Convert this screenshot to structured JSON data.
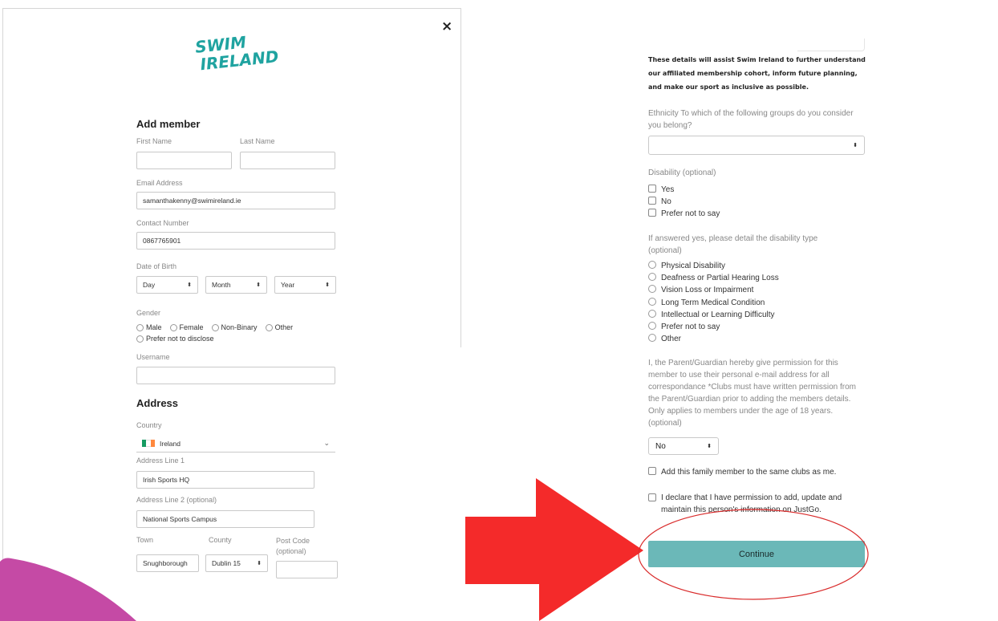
{
  "brand": {
    "logo_line1": "SWIM",
    "logo_line2": "IRELAND",
    "logo_color": "#1fa3a0"
  },
  "left_form": {
    "title": "Add member",
    "first_name_label": "First Name",
    "last_name_label": "Last Name",
    "email_label": "Email Address",
    "email_value": "samanthakenny@swimireland.ie",
    "contact_label": "Contact Number",
    "contact_value": "0867765901",
    "dob_label": "Date of Birth",
    "dob_day": "Day",
    "dob_month": "Month",
    "dob_year": "Year",
    "gender_label": "Gender",
    "gender_options": [
      "Male",
      "Female",
      "Non-Binary",
      "Other",
      "Prefer not to disclose"
    ],
    "username_label": "Username",
    "address_title": "Address",
    "country_label": "Country",
    "country_value": "Ireland",
    "address1_label": "Address Line 1",
    "address1_value": "Irish Sports HQ",
    "address2_label": "Address Line 2 (optional)",
    "address2_value": "National Sports Campus",
    "town_label": "Town",
    "town_value": "Snughborough",
    "county_label": "County",
    "county_value": "Dublin 15",
    "postcode_label": "Post Code (optional)",
    "close_glyph": "×"
  },
  "right_form": {
    "intro": "These details will assist Swim Ireland to further understand our affiliated membership cohort, inform future planning, and make our sport as inclusive as possible.",
    "ethnicity_label": "Ethnicity To which of the following groups do you consider you belong?",
    "disability_label": "Disability (optional)",
    "disability_options": [
      "Yes",
      "No",
      "Prefer not to say"
    ],
    "disability_type_label": "If answered yes, please detail the disability type (optional)",
    "disability_type_options": [
      "Physical Disability",
      "Deafness or Partial Hearing Loss",
      "Vision Loss or Impairment",
      "Long Term Medical Condition",
      "Intellectual or Learning Difficulty",
      "Prefer not to say",
      "Other"
    ],
    "permission_text": "I, the Parent/Guardian hereby give permission for this member to use their personal e-mail address for all correspondance *Clubs must have written permission from the Parent/Guardian prior to adding the members details. Only applies to members under the age of 18 years. (optional)",
    "permission_value": "No",
    "same_clubs_label": "Add this family member to the same clubs as me.",
    "declare_label": "I declare that I have permission to add, update and maintain this person's information on JustGo.",
    "continue_label": "Continue"
  },
  "colors": {
    "arrow": "#f42a2a",
    "highlight": "#d92b2b",
    "button": "#6bb8b8",
    "pink": "#c54aa5"
  }
}
